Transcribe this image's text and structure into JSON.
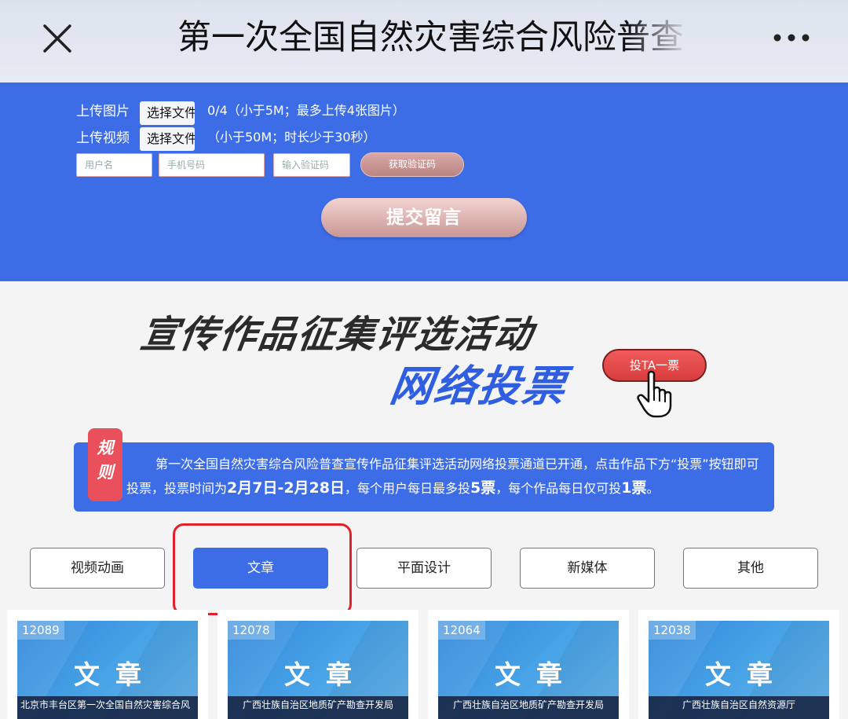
{
  "header": {
    "title": "第一次全国自然灾害综合风险普查"
  },
  "form": {
    "upload_image_label": "上传图片",
    "upload_video_label": "上传视频",
    "choose_file_label": "选择文件",
    "image_hint": "0/4（小于5M；最多上传4张图片）",
    "video_hint": "（小于50M；时长少于30秒）",
    "username_placeholder": "用户名",
    "phone_placeholder": "手机号码",
    "code_placeholder": "输入验证码",
    "get_code_label": "获取验证码",
    "submit_label": "提交留言"
  },
  "banner": {
    "line1": "宣传作品征集评选活动",
    "line2": "网络投票",
    "vote_label": "投TA一票"
  },
  "rules": {
    "tag": [
      "规",
      "则"
    ],
    "text_a": "第一次全国自然灾害综合风险普查宣传作品征集评选活动网络投票通道已开通，点击作品下方“投票”按钮即可投票，投票时间为",
    "date_range": "2月7日-2月28日",
    "text_b": "，每个用户每日最多投",
    "max_votes": "5票",
    "text_c": "，每个作品每日仅可投",
    "per_work": "1票",
    "text_d": "。"
  },
  "tabs": [
    {
      "label": "视频动画",
      "active": false
    },
    {
      "label": "文章",
      "active": true
    },
    {
      "label": "平面设计",
      "active": false
    },
    {
      "label": "新媒体",
      "active": false
    },
    {
      "label": "其他",
      "active": false
    }
  ],
  "cards": [
    {
      "id": "12089",
      "category": "文章",
      "caption": "北京市丰台区第一次全国自然灾害综合风"
    },
    {
      "id": "12078",
      "category": "文章",
      "caption": "广西壮族自治区地质矿产勘查开发局"
    },
    {
      "id": "12064",
      "category": "文章",
      "caption": "广西壮族自治区地质矿产勘查开发局"
    },
    {
      "id": "12038",
      "category": "文章",
      "caption": "广西壮族自治区自然资源厅"
    }
  ],
  "colors": {
    "primary_blue": "#3c6ce6",
    "highlight_red": "#e0202a",
    "rules_tag_red": "#e9505c"
  }
}
